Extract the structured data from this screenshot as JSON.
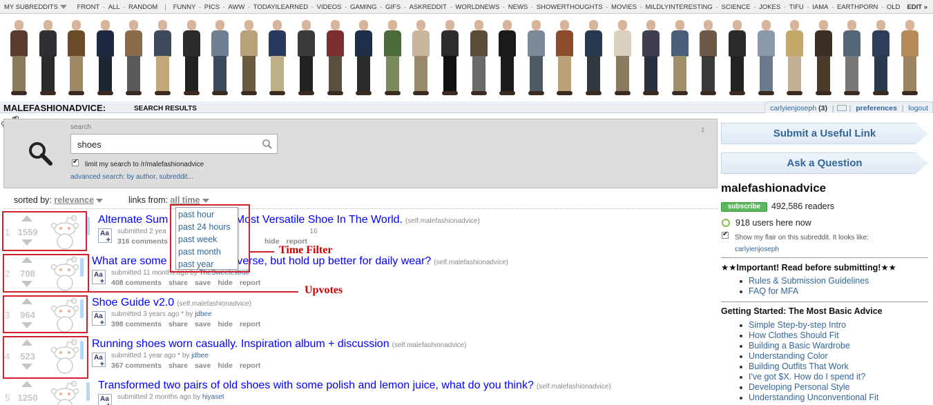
{
  "topbar": {
    "my_subreddits": "MY SUBREDDITS",
    "links": [
      "FRONT",
      "ALL",
      "RANDOM"
    ],
    "subs": [
      "FUNNY",
      "PICS",
      "AWW",
      "TODAYILEARNED",
      "VIDEOS",
      "GAMING",
      "GIFS",
      "ASKREDDIT",
      "WORLDNEWS",
      "NEWS",
      "SHOWERTHOUGHTS",
      "MOVIES",
      "MILDLYINTERESTING",
      "SCIENCE",
      "JOKES",
      "TIFU",
      "IAMA",
      "EARTHPORN",
      "OLDSCHOOL"
    ],
    "edit": "EDIT »"
  },
  "header": {
    "subreddit": "MALEFASHIONADVICE:",
    "page": "SEARCH RESULTS",
    "user": "carlyienjoseph",
    "karma": "(3)",
    "preferences": "preferences",
    "logout": "logout"
  },
  "search": {
    "label": "search",
    "query": "shoes",
    "restrict_label": "limit my search to /r/malefashionadvice",
    "advanced": "advanced search: by author, subreddit..."
  },
  "sort": {
    "sorted_by_label": "sorted by:",
    "sorted_by_value": "relevance",
    "links_from_label": "links from:",
    "links_from_value": "all time",
    "time_options": [
      "past hour",
      "past 24 hours",
      "past week",
      "past month",
      "past year"
    ]
  },
  "posts": [
    {
      "rank": "1",
      "score": "1559",
      "title": "Alternate Sum",
      "title_tail": "Crocs, The Most Versatile Shoe In The World.",
      "domain": "(self.malefashionadvice)",
      "tagline": "submitted 2 yea",
      "tagline_tail": "16",
      "comments": "316 comments",
      "hide": "hide",
      "report": "report"
    },
    {
      "rank": "2",
      "score": "708",
      "title": "What are some",
      "title_tail": "Vans or Converse, but hold up better for daily wear?",
      "domain": "(self.malefashionadvice)",
      "tagline": "submitted 11 months ago by",
      "author": "TheSweetestKill",
      "comments": "408 comments",
      "share": "share",
      "save": "save",
      "hide": "hide",
      "report": "report"
    },
    {
      "rank": "3",
      "score": "964",
      "title": "Shoe Guide v2.0",
      "domain": "(self.malefashionadvice)",
      "tagline": "submitted 3 years ago * by",
      "author": "jdbee",
      "comments": "398 comments",
      "share": "share",
      "save": "save",
      "hide": "hide",
      "report": "report"
    },
    {
      "rank": "4",
      "score": "523",
      "title": "Running shoes worn casually. Inspiration album + discussion",
      "domain": "(self.malefashionadvice)",
      "tagline": "submitted 1 year ago * by",
      "author": "jdbee",
      "comments": "367 comments",
      "share": "share",
      "save": "save",
      "hide": "hide",
      "report": "report"
    },
    {
      "rank": "5",
      "score": "1250",
      "title": "Transformed two pairs of old shoes with some polish and lemon juice, what do you think?",
      "domain": "(self.malefashionadvice)",
      "tagline": "submitted 2 months ago by",
      "author": "hiyaset"
    }
  ],
  "annotations": {
    "time_filter": "Time Filter",
    "upvotes": "Upvotes",
    "color": "#d21f2b"
  },
  "sidebar": {
    "submit_link": "Submit a Useful Link",
    "ask_question": "Ask a Question",
    "title": "malefashionadvice",
    "subscribe": "subscribe",
    "readers": "492,586 readers",
    "online": "918 users here now",
    "flair_text": "Show my flair on this subreddit. It looks like:",
    "flair_user": "carlyienjoseph",
    "important_heading": "★★Important! Read before submitting!★★",
    "important_links": [
      "Rules & Submission Guidelines",
      "FAQ for MFA"
    ],
    "started_heading": "Getting Started: The Most Basic Advice",
    "started_links": [
      "Simple Step-by-step Intro",
      "How Clothes Should Fit",
      "Building a Basic Wardrobe",
      "Understanding Color",
      "Building Outfits That Work",
      "I've got $X. How do I spend it?",
      "Developing Personal Style",
      "Understanding Unconventional Fit"
    ]
  },
  "colors": {
    "link_blue": "#369",
    "title_blue": "#0000ff",
    "vote_grey": "#c6c6c6"
  }
}
